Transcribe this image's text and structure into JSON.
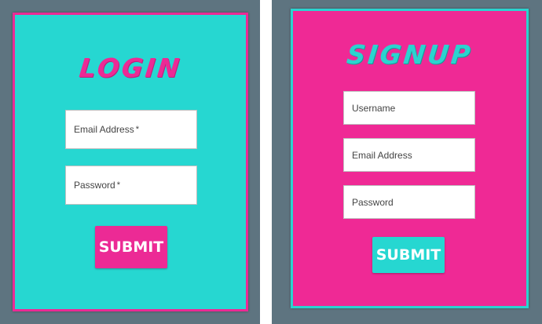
{
  "login": {
    "title": "LOGIN",
    "email_placeholder": "Email Address",
    "password_placeholder": "Password",
    "required_mark": "*",
    "submit_label": "SUBMIT"
  },
  "signup": {
    "title": "SIGNUP",
    "username_placeholder": "Username",
    "email_placeholder": "Email Address",
    "password_placeholder": "Password",
    "submit_label": "SUBMIT"
  },
  "colors": {
    "background": "#5e7480",
    "pink": "#ef2995",
    "cyan": "#26d7d1",
    "white": "#ffffff"
  }
}
